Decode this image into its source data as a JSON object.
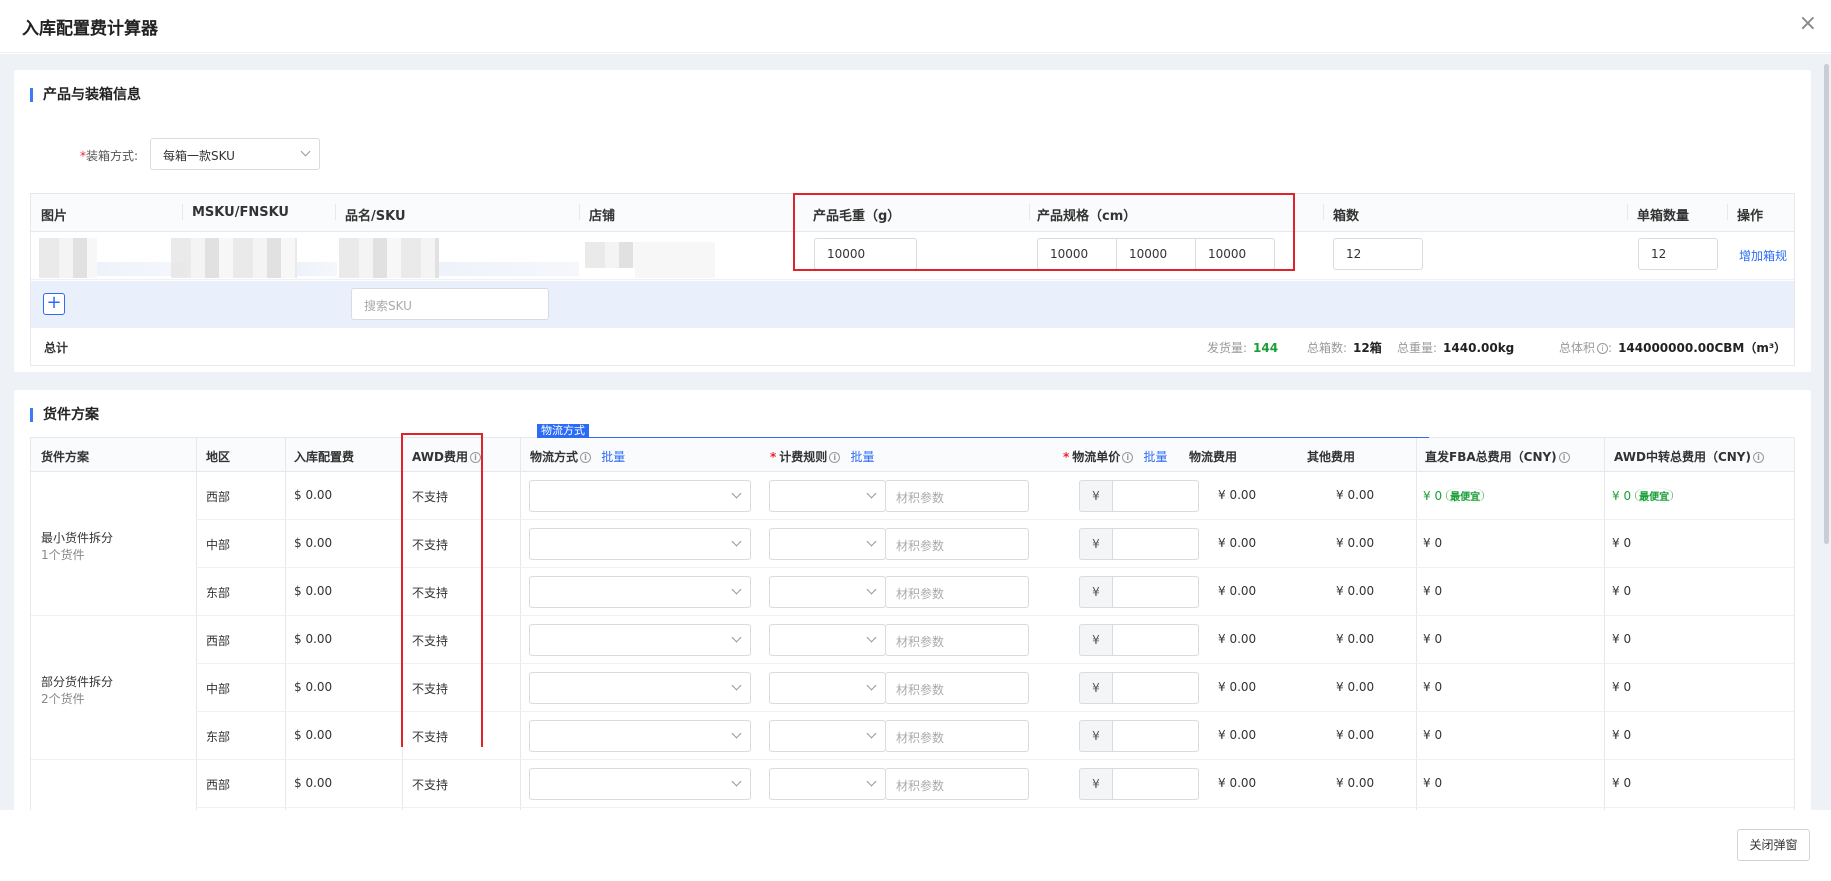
{
  "modal": {
    "title": "入库配置费计算器",
    "close_icon": "×",
    "close_button": "关闭弹窗"
  },
  "product_section": {
    "title": "产品与装箱信息",
    "packing_label": "装箱方式:",
    "packing_required": "*",
    "packing_value": "每箱一款SKU",
    "columns": [
      "图片",
      "MSKU/FNSKU",
      "品名/SKU",
      "店铺",
      "产品毛重（g）",
      "产品规格（cm）",
      "箱数",
      "单箱数量",
      "操作"
    ],
    "row": {
      "gross_weight": "10000",
      "dim_l": "10000",
      "dim_w": "10000",
      "dim_h": "10000",
      "box_count": "12",
      "qty_per_box": "12",
      "action": "增加箱规"
    },
    "add_icon": "+",
    "search_placeholder": "搜索SKU",
    "totals": {
      "label": "总计",
      "ship_qty_label": "发货量:",
      "ship_qty": "144",
      "total_boxes_label": "总箱数:",
      "total_boxes": "12箱",
      "total_weight_label": "总重量:",
      "total_weight": "1440.00kg",
      "total_volume_label": "总体积",
      "total_volume_colon": ":",
      "total_volume": "144000000.00CBM（m³）"
    }
  },
  "shipment_section": {
    "title": "货件方案",
    "tab_label": "物流方式",
    "columns": {
      "plan": "货件方案",
      "region": "地区",
      "inbound_fee": "入库配置费",
      "awd_fee": "AWD费用",
      "logistics_method": "物流方式",
      "batch1": "批量",
      "billing_rule": "计费规则",
      "batch2": "批量",
      "unit_price": "物流单价",
      "batch3": "批量",
      "logistics_cost": "物流费用",
      "other_cost": "其他费用",
      "fba_total": "直发FBA总费用（CNY)",
      "awd_total": "AWD中转总费用（CNY)"
    },
    "required_mark": "*",
    "material_placeholder": "材积参数",
    "yuan_symbol": "¥",
    "cheapest_tag": "最便宜",
    "plans": [
      {
        "name": "最小货件拆分",
        "sub": "1个货件"
      },
      {
        "name": "部分货件拆分",
        "sub": "2个货件"
      }
    ],
    "rows": [
      {
        "region": "西部",
        "inbound_fee": "$ 0.00",
        "awd": "不支持",
        "logistics_cost": "¥ 0.00",
        "other_cost": "¥ 0.00",
        "fba_total": "¥ 0",
        "awd_total": "¥ 0"
      },
      {
        "region": "中部",
        "inbound_fee": "$ 0.00",
        "awd": "不支持",
        "logistics_cost": "¥ 0.00",
        "other_cost": "¥ 0.00",
        "fba_total": "¥ 0",
        "awd_total": "¥ 0"
      },
      {
        "region": "东部",
        "inbound_fee": "$ 0.00",
        "awd": "不支持",
        "logistics_cost": "¥ 0.00",
        "other_cost": "¥ 0.00",
        "fba_total": "¥ 0",
        "awd_total": "¥ 0"
      },
      {
        "region": "西部",
        "inbound_fee": "$ 0.00",
        "awd": "不支持",
        "logistics_cost": "¥ 0.00",
        "other_cost": "¥ 0.00",
        "fba_total": "¥ 0",
        "awd_total": "¥ 0"
      },
      {
        "region": "中部",
        "inbound_fee": "$ 0.00",
        "awd": "不支持",
        "logistics_cost": "¥ 0.00",
        "other_cost": "¥ 0.00",
        "fba_total": "¥ 0",
        "awd_total": "¥ 0"
      },
      {
        "region": "东部",
        "inbound_fee": "$ 0.00",
        "awd": "不支持",
        "logistics_cost": "¥ 0.00",
        "other_cost": "¥ 0.00",
        "fba_total": "¥ 0",
        "awd_total": "¥ 0"
      },
      {
        "region": "西部",
        "inbound_fee": "$ 0.00",
        "awd": "不支持",
        "logistics_cost": "¥ 0.00",
        "other_cost": "¥ 0.00",
        "fba_total": "¥ 0",
        "awd_total": "¥ 0"
      }
    ]
  },
  "colors": {
    "accent": "#2c6cf5",
    "highlight_border": "#e0222a",
    "success": "#1a9e36"
  }
}
